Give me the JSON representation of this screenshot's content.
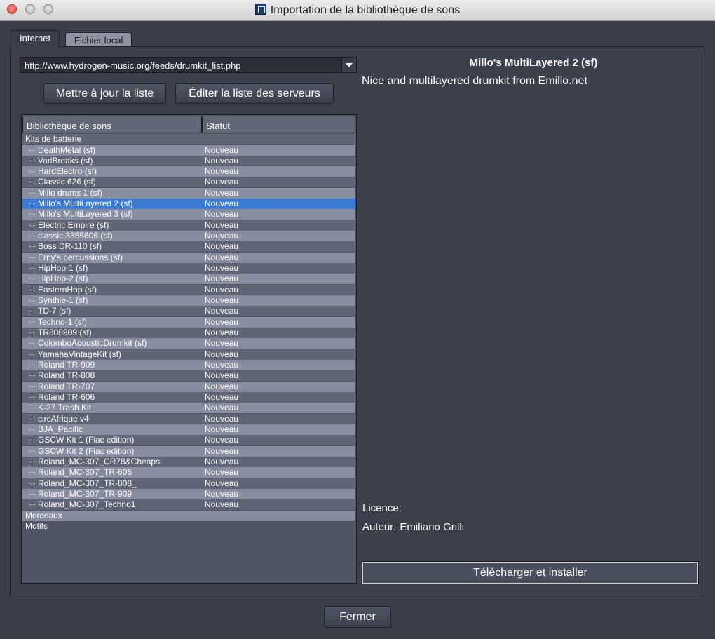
{
  "window": {
    "title": "Importation de la bibliothèque de sons"
  },
  "tabs": [
    {
      "label": "Internet",
      "active": true
    },
    {
      "label": "Fichier local",
      "active": false
    }
  ],
  "server": {
    "url": "http://www.hydrogen-music.org/feeds/drumkit_list.php"
  },
  "buttons": {
    "update": "Mettre à jour la liste",
    "edit_servers": "Éditer la liste des serveurs",
    "download": "Télécharger et installer",
    "close": "Fermer"
  },
  "table": {
    "columns": [
      "Bibliothèque de sons",
      "Statut"
    ],
    "groups": {
      "drumkits": "Kits de batterie",
      "songs": "Morceaux",
      "patterns": "Motifs"
    },
    "rows": [
      {
        "name": "DeathMetal (sf)",
        "status": "Nouveau"
      },
      {
        "name": "VariBreaks (sf)",
        "status": "Nouveau"
      },
      {
        "name": "HardElectro (sf)",
        "status": "Nouveau"
      },
      {
        "name": "Classic 626 (sf)",
        "status": "Nouveau"
      },
      {
        "name": "Millo drums 1 (sf)",
        "status": "Nouveau"
      },
      {
        "name": "Millo's MultiLayered 2 (sf)",
        "status": "Nouveau",
        "selected": true
      },
      {
        "name": "Millo's MultiLayered 3 (sf)",
        "status": "Nouveau"
      },
      {
        "name": "Electric Empire (sf)",
        "status": "Nouveau"
      },
      {
        "name": "classic 3355606 (sf)",
        "status": "Nouveau"
      },
      {
        "name": "Boss DR-110 (sf)",
        "status": "Nouveau"
      },
      {
        "name": "Erny's percussions (sf)",
        "status": "Nouveau"
      },
      {
        "name": "HipHop-1 (sf)",
        "status": "Nouveau"
      },
      {
        "name": "HipHop-2 (sf)",
        "status": "Nouveau"
      },
      {
        "name": "EasternHop (sf)",
        "status": "Nouveau"
      },
      {
        "name": "Synthie-1 (sf)",
        "status": "Nouveau"
      },
      {
        "name": "TD-7 (sf)",
        "status": "Nouveau"
      },
      {
        "name": "Techno-1 (sf)",
        "status": "Nouveau"
      },
      {
        "name": "TR808909 (sf)",
        "status": "Nouveau"
      },
      {
        "name": "ColomboAcousticDrumkit (sf)",
        "status": "Nouveau"
      },
      {
        "name": "YamahaVintageKit (sf)",
        "status": "Nouveau"
      },
      {
        "name": "Roland TR-909",
        "status": "Nouveau"
      },
      {
        "name": "Roland TR-808",
        "status": "Nouveau"
      },
      {
        "name": "Roland TR-707",
        "status": "Nouveau"
      },
      {
        "name": "Roland TR-606",
        "status": "Nouveau"
      },
      {
        "name": "K-27 Trash Kit",
        "status": "Nouveau"
      },
      {
        "name": "circAfrique v4",
        "status": "Nouveau"
      },
      {
        "name": "BJA_Pacific",
        "status": "Nouveau"
      },
      {
        "name": "GSCW Kit 1 (Flac edition)",
        "status": "Nouveau"
      },
      {
        "name": "GSCW Kit 2 (Flac edition)",
        "status": "Nouveau"
      },
      {
        "name": "Roland_MC-307_CR78&Cheaps",
        "status": "Nouveau"
      },
      {
        "name": "Roland_MC-307_TR-606",
        "status": "Nouveau"
      },
      {
        "name": "Roland_MC-307_TR-808_",
        "status": "Nouveau"
      },
      {
        "name": "Roland_MC-307_TR-909",
        "status": "Nouveau"
      },
      {
        "name": "Roland_MC-307_Techno1",
        "status": "Nouveau"
      }
    ]
  },
  "detail": {
    "title": "Millo's MultiLayered 2 (sf)",
    "description": "Nice and multilayered drumkit from Emillo.net",
    "licence_label": "Licence:",
    "licence_value": "",
    "author_label": "Auteur:",
    "author_value": "Emiliano Grilli"
  },
  "colors": {
    "background": "#3a3e4b",
    "selection": "#3a7bd5"
  }
}
